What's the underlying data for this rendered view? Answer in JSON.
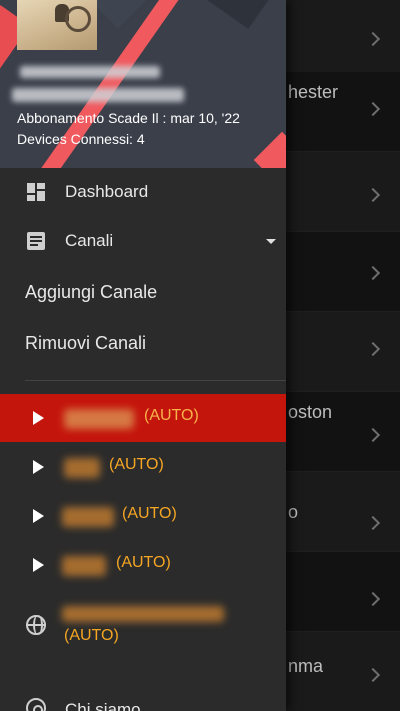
{
  "background_list": {
    "rows": [
      {
        "title": ""
      },
      {
        "title": "hester"
      },
      {
        "title": ""
      },
      {
        "title": ""
      },
      {
        "title": ""
      },
      {
        "title": "oston"
      },
      {
        "title": "o"
      },
      {
        "title": ""
      },
      {
        "title": "nma"
      }
    ]
  },
  "drawer": {
    "header": {
      "subscription": "Abbonamento Scade Il : mar 10, '22",
      "devices": "Devices Connessi: 4"
    },
    "menu": {
      "dashboard": "Dashboard",
      "channels": "Canali",
      "add_channel": "Aggiungi Canale",
      "remove_channels": "Rimuovi Canali"
    },
    "channels": [
      {
        "auto": "(AUTO)",
        "active": true
      },
      {
        "auto": "(AUTO)",
        "active": false
      },
      {
        "auto": "(AUTO)",
        "active": false
      },
      {
        "auto": "(AUTO)",
        "active": false
      }
    ],
    "web_item": {
      "auto": "(AUTO)"
    },
    "about": "Chi siamo"
  },
  "colors": {
    "drawer_bg": "#2b2b2b",
    "active_red": "#c4150c",
    "auto_orange": "#f5a623",
    "header_accent": "#f05a5f"
  }
}
